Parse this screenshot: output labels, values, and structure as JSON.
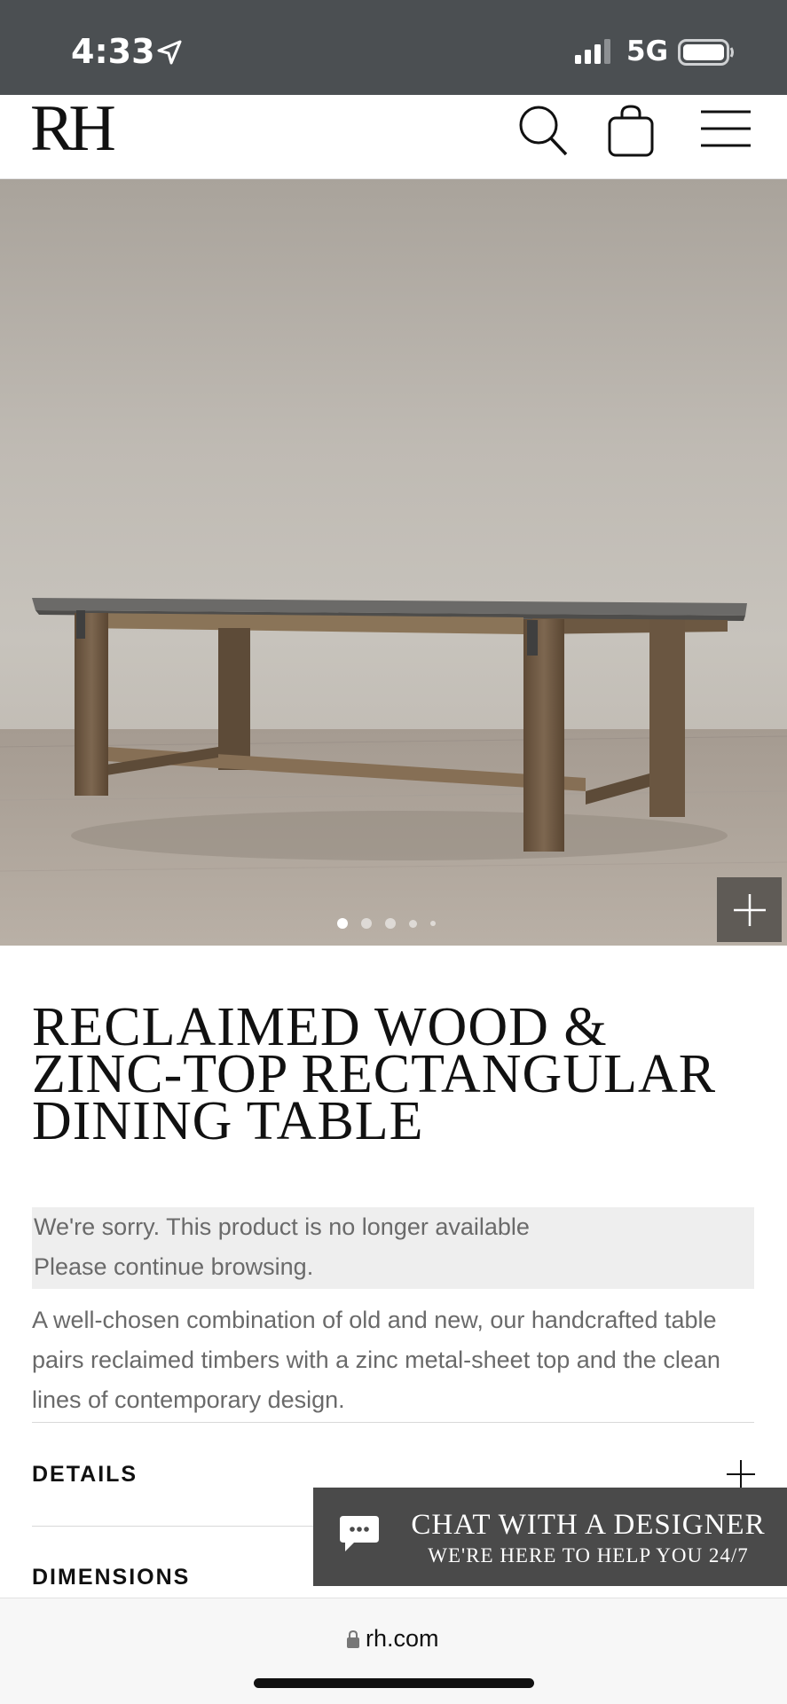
{
  "status": {
    "time": "4:33",
    "network": "5G"
  },
  "header": {
    "logo": "RH"
  },
  "gallery": {
    "slide_count": 5,
    "active_index": 0
  },
  "product": {
    "title": "RECLAIMED WOOD & ZINC-TOP RECTANGULAR DINING TABLE",
    "notice_line1": "We're sorry. This product is no longer available",
    "notice_line2": "Please continue browsing.",
    "description": "A well-chosen combination of old and new, our handcrafted table pairs reclaimed timbers with a zinc metal-sheet top and the clean lines of contemporary design."
  },
  "accordion": {
    "details_label": "DETAILS",
    "dimensions_label": "DIMENSIONS"
  },
  "chat": {
    "title": "CHAT WITH A DESIGNER",
    "subtitle": "WE'RE HERE TO HELP YOU 24/7"
  },
  "browser": {
    "url": "rh.com"
  },
  "colors": {
    "status_bar": "#4b4f52",
    "chat_bg": "#4a4a4a",
    "notice_bg": "#eeeeee"
  }
}
